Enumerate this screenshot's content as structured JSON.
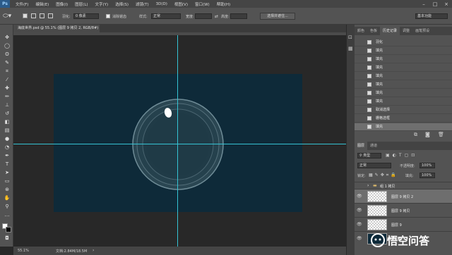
{
  "menubar": {
    "logo": "Ps",
    "items": [
      "文件(F)",
      "编辑(E)",
      "图像(I)",
      "图层(L)",
      "文字(Y)",
      "选择(S)",
      "滤镜(T)",
      "3D(D)",
      "视图(V)",
      "窗口(W)",
      "帮助(H)"
    ]
  },
  "options": {
    "feather_label": "羽化:",
    "feather_value": "0 像素",
    "antialias_label": "消除锯齿",
    "style_label": "样式:",
    "style_value": "正常",
    "width_label": "宽度:",
    "height_label": "高度:",
    "select_mask_button": "选择并遮住...",
    "workspace_value": "基本功能"
  },
  "document": {
    "tab_title": "海底世界.psd @ 55.1% (图层 9 拷贝 2, RGB/8#) *",
    "zoom": "55.1%",
    "doc_info": "文档:2.84M/18.5M"
  },
  "history_panel": {
    "tabs": [
      "颜色",
      "色板",
      "历史记录",
      "调整",
      "画笔预设"
    ],
    "active_tab": "历史记录",
    "items": [
      "羽化",
      "填充",
      "填充",
      "填充",
      "填充",
      "填充",
      "填充",
      "填充",
      "取消选择",
      "栅格选框",
      "填充"
    ]
  },
  "layers_panel": {
    "tabs": [
      "图层",
      "通道"
    ],
    "kind_filter": "类型",
    "blend_mode": "正常",
    "opacity_label": "不透明度:",
    "opacity_value": "100%",
    "lock_label": "锁定:",
    "fill_label": "填充:",
    "fill_value": "100%",
    "group_name": "组 1 拷贝",
    "layers": [
      "图层 9 拷贝 2",
      "图层 9 拷贝",
      "图层 9",
      "图层 8"
    ]
  },
  "watermark": {
    "text": "悟空问答"
  },
  "colors": {
    "canvas_bg": "#0e2a39",
    "guide": "#35c3d4",
    "panel_bg": "#535353",
    "workspace_bg": "#282828"
  }
}
